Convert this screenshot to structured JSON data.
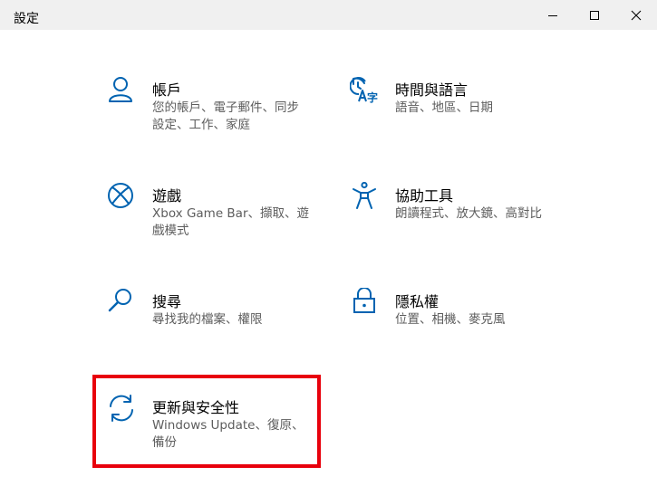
{
  "window": {
    "title": "設定"
  },
  "accent_color": "#0063b1",
  "highlight_color": "#e8000c",
  "tiles": {
    "accounts": {
      "name": "帳戶",
      "desc": "您的帳戶、電子郵件、同步設定、工作、家庭",
      "icon": "person-icon"
    },
    "time_language": {
      "name": "時間與語言",
      "desc": "語音、地區、日期",
      "icon": "time-language-icon"
    },
    "gaming": {
      "name": "遊戲",
      "desc": "Xbox Game Bar、擷取、遊戲模式",
      "icon": "xbox-icon"
    },
    "ease_of_access": {
      "name": "協助工具",
      "desc": "朗讀程式、放大鏡、高對比",
      "icon": "accessibility-icon"
    },
    "search": {
      "name": "搜尋",
      "desc": "尋找我的檔案、權限",
      "icon": "search-icon"
    },
    "privacy": {
      "name": "隱私權",
      "desc": "位置、相機、麥克風",
      "icon": "lock-icon"
    },
    "update_security": {
      "name": "更新與安全性",
      "desc": "Windows Update、復原、備份",
      "icon": "sync-icon"
    }
  }
}
